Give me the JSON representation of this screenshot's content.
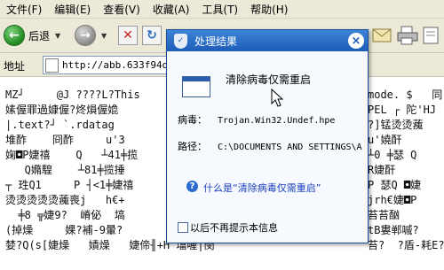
{
  "menu": [
    "文件(F)",
    "编辑(E)",
    "查看(V)",
    "收藏(A)",
    "工具(T)",
    "帮助(H)"
  ],
  "toolbar": {
    "back_label": "后退",
    "back_glyph": "←",
    "forward_glyph": "→",
    "stop_glyph": "✕",
    "refresh_glyph": "↻"
  },
  "address": {
    "label": "地址",
    "url": "http://abb.633f94d3"
  },
  "page_lines": [
    "MZ┘     @J ????L?This",
    "嫊偓罪過嫝偓?炵熉偓嫓",
    "|.text?┘ `.rdatag",
    "堆酢    冏酢     u'3",
    "婅◘P婕禧    Q   ┴41╪揽",
    "   Q嫷騜    ┴81╪揽捶",
    "┬ 珄Q1     P ┤<1╪婕禧",
    "烫烫烫烫烫藱喪j   h€+",
    "  ╪8 ╦婕9?  嵴佖  塙",
    "(掉燥     婐?補-9暈?",
    "婪?Q(s[婕燥   嫧燥   婕偙╢+H 墖喔|閔"
  ],
  "page_lines_right": [
    "mode. $   同",
    "PEL ┌ 陀'HJ",
    "?]锰烫烫藱",
    "u'嬈酐",
    "┴0 ╪瑟 Q",
    "R婕酐",
    "P 瑟Q ◘婕",
    "jrh€婕◘P",
    "苔苔酗",
    "tB婁郸嘁?",
    "苔?  ?盾-耗E?"
  ],
  "dialog": {
    "title": "处理结果",
    "close_glyph": "×",
    "shield_glyph": "✓",
    "headline": "清除病毒仅需重启",
    "virus_label": "病毒：",
    "virus_value": "Trojan.Win32.Undef.hpe",
    "path_label": "路径：",
    "path_value": "C:\\DOCUMENTS AND SETTINGS\\A",
    "help_glyph": "?",
    "help_link": "什么是“清除病毒仅需重启”",
    "dont_show": "以后不再提示本信息"
  }
}
